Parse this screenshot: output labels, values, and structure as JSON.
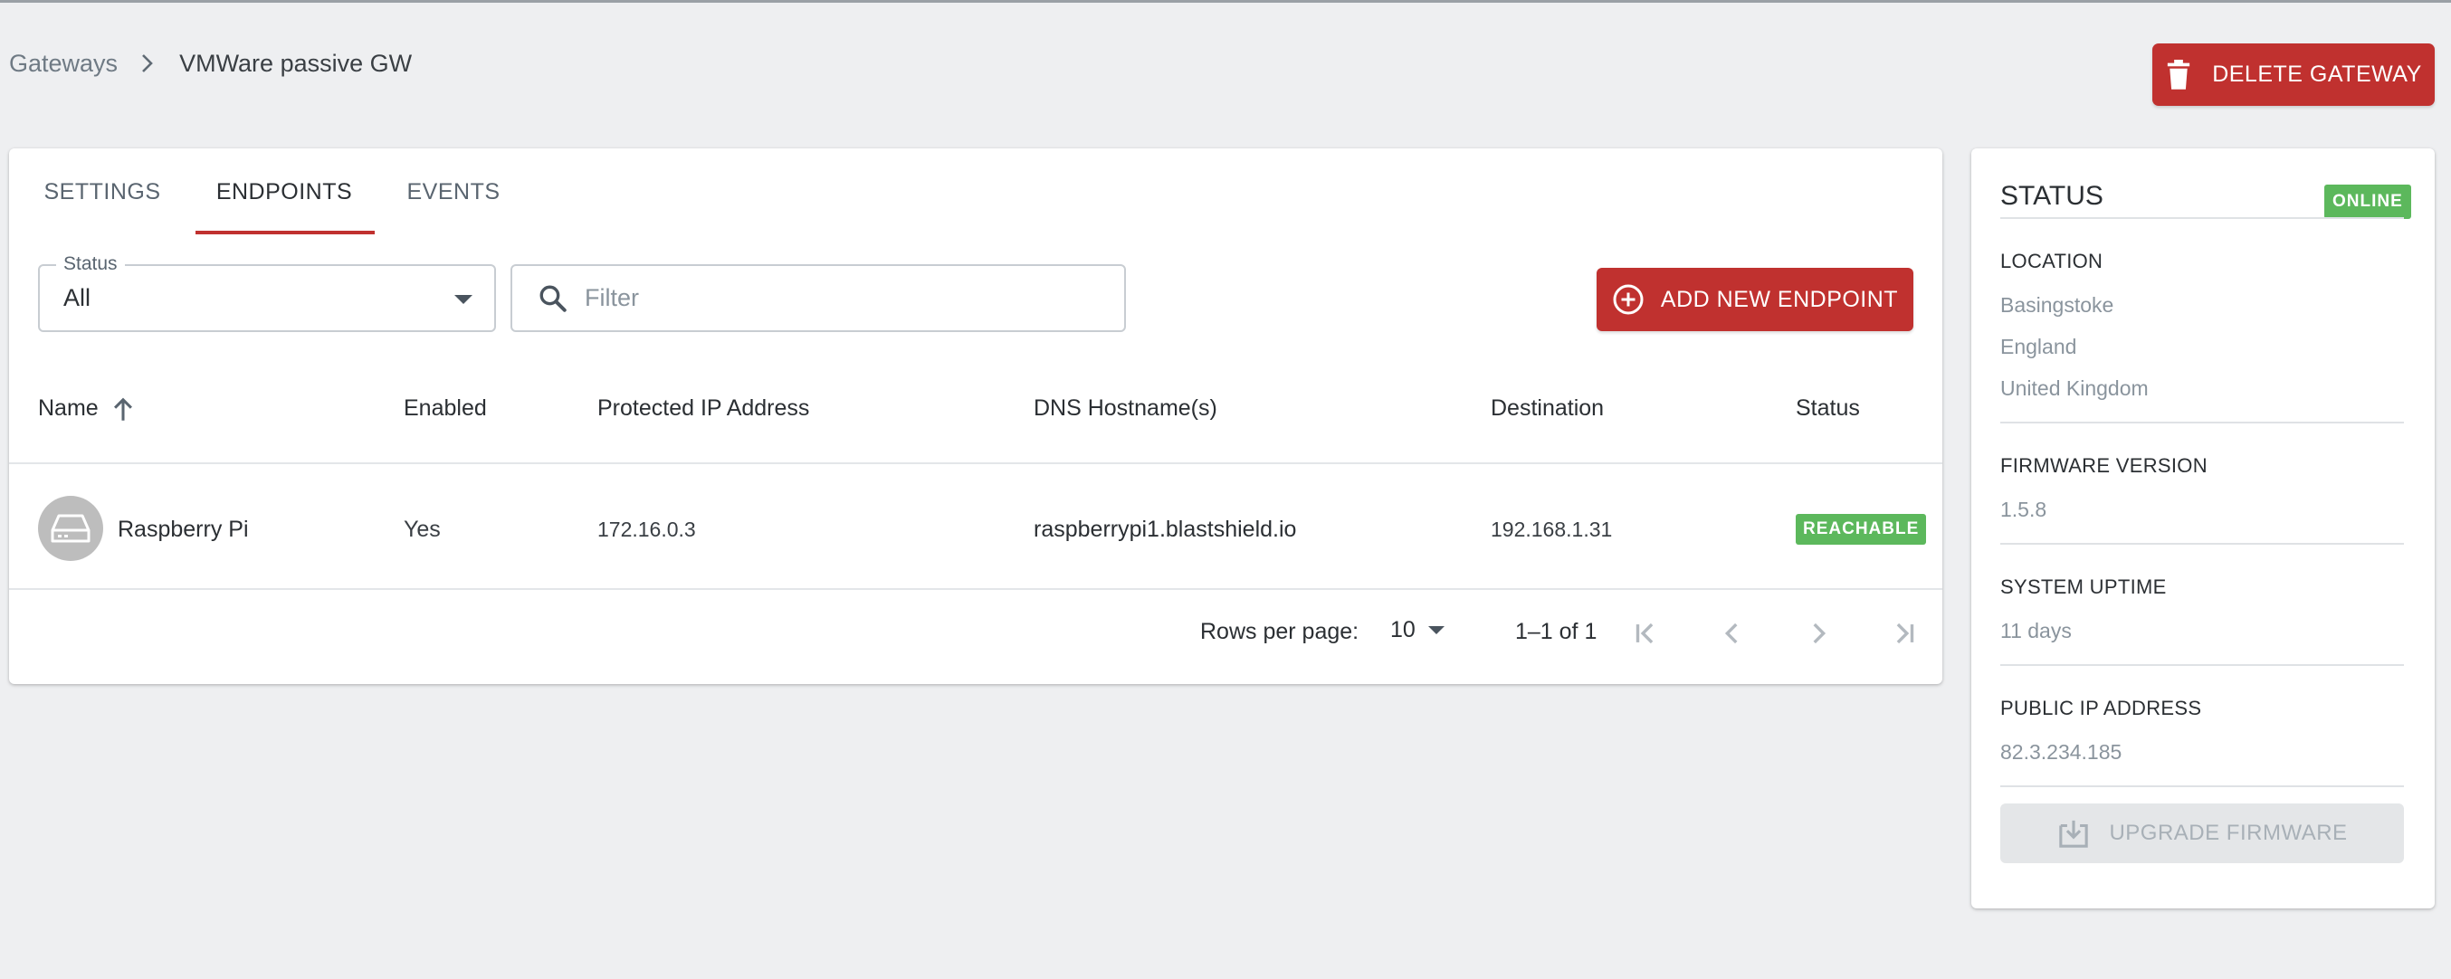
{
  "breadcrumb": {
    "parent": "Gateways",
    "current": "VMWare passive GW"
  },
  "header": {
    "delete_label": "DELETE GATEWAY"
  },
  "tabs": [
    {
      "label": "SETTINGS",
      "active": false
    },
    {
      "label": "ENDPOINTS",
      "active": true
    },
    {
      "label": "EVENTS",
      "active": false
    }
  ],
  "filters": {
    "status_label": "Status",
    "status_value": "All",
    "search_placeholder": "Filter",
    "search_value": ""
  },
  "actions": {
    "add_endpoint_label": "ADD NEW ENDPOINT"
  },
  "table": {
    "columns": [
      "Name",
      "Enabled",
      "Protected IP Address",
      "DNS Hostname(s)",
      "Destination",
      "Status"
    ],
    "sort_column": "Name",
    "sort_direction": "ascending",
    "rows": [
      {
        "name": "Raspberry Pi",
        "enabled": "Yes",
        "protected_ip": "172.16.0.3",
        "dns": "raspberrypi1.blastshield.io",
        "destination": "192.168.1.31",
        "status": "REACHABLE"
      }
    ]
  },
  "pagination": {
    "rows_per_page_label": "Rows per page:",
    "rows_per_page": "10",
    "range": "1–1 of 1"
  },
  "status_panel": {
    "title": "STATUS",
    "badge": "ONLINE",
    "location_label": "LOCATION",
    "location_lines": [
      "Basingstoke",
      "England",
      "United Kingdom"
    ],
    "firmware_label": "FIRMWARE VERSION",
    "firmware_value": "1.5.8",
    "uptime_label": "SYSTEM UPTIME",
    "uptime_value": "11 days",
    "public_ip_label": "PUBLIC IP ADDRESS",
    "public_ip_value": "82.3.234.185",
    "upgrade_label": "UPGRADE FIRMWARE"
  },
  "colors": {
    "accent": "#c0312f",
    "success": "#5cb85c",
    "background": "#eeeff1"
  },
  "icons": {
    "delete": "trash-icon",
    "search": "search-icon",
    "add": "plus-circle-icon",
    "sort": "arrow-up-icon",
    "device": "hard-drive-icon",
    "upgrade": "download-box-icon"
  }
}
